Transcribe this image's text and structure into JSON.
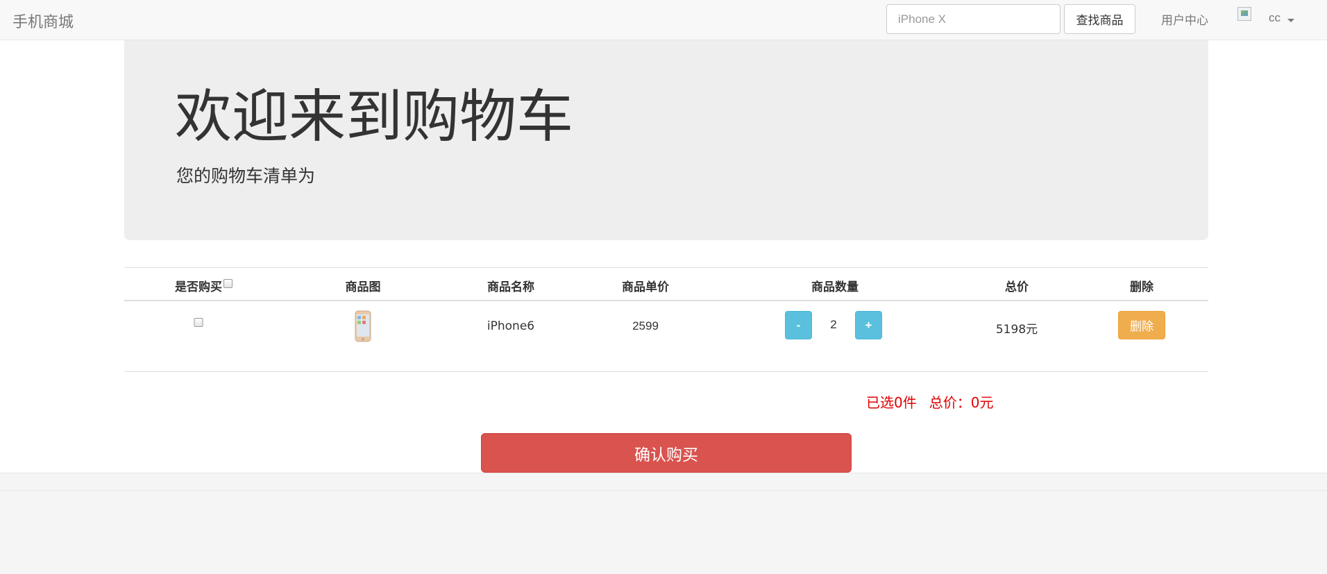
{
  "navbar": {
    "brand": "手机商城",
    "search_placeholder": "iPhone X",
    "search_button": "查找商品",
    "user_center": "用户中心",
    "username": "cc"
  },
  "jumbotron": {
    "title": "欢迎来到购物车",
    "subtitle": "您的购物车清单为"
  },
  "table": {
    "headers": [
      "是否购买",
      "商品图",
      "商品名称",
      "商品单价",
      "商品数量",
      "总价",
      "删除"
    ],
    "rows": [
      {
        "name": "iPhone6",
        "unit_price": "2599",
        "minus": "-",
        "quantity": "2",
        "plus": "+",
        "total": "5198元",
        "delete": "删除"
      }
    ]
  },
  "summary": {
    "selected": "已选0件",
    "total": "总价：0元"
  },
  "confirm_button": "确认购买"
}
